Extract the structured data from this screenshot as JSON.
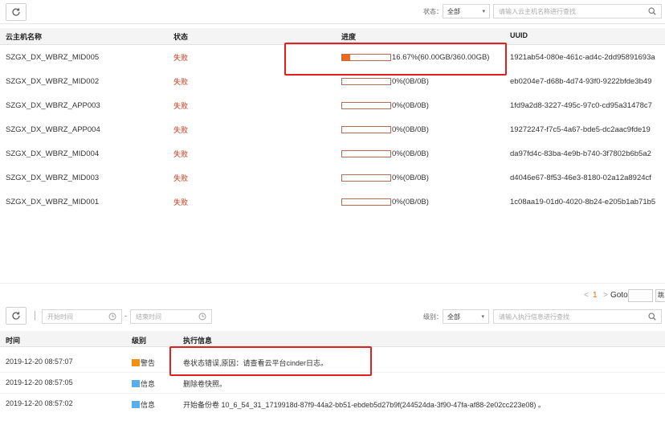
{
  "colors": {
    "accent": "#ee6a1b",
    "fail": "#d0361a",
    "warning": "#f0900f",
    "info": "#58aee8",
    "highlight": "#e22020"
  },
  "top_toolbar": {
    "status_label": "状态：",
    "status_value": "全部",
    "search_placeholder": "请输入云主机名称进行查找"
  },
  "vm_table": {
    "headers": {
      "name": "云主机名称",
      "status": "状态",
      "progress": "进度",
      "uuid": "UUID"
    },
    "rows": [
      {
        "name": "SZGX_DX_WBRZ_MID005",
        "status": "失败",
        "progress_pct": 16.67,
        "progress_text": "16.67%(60.00GB/360.00GB)",
        "uuid": "1921ab54-080e-461c-ad4c-2dd95891693a"
      },
      {
        "name": "SZGX_DX_WBRZ_MID002",
        "status": "失败",
        "progress_pct": 0,
        "progress_text": "0%(0B/0B)",
        "uuid": "eb0204e7-d68b-4d74-93f0-9222bfde3b49"
      },
      {
        "name": "SZGX_DX_WBRZ_APP003",
        "status": "失败",
        "progress_pct": 0,
        "progress_text": "0%(0B/0B)",
        "uuid": "1fd9a2d8-3227-495c-97c0-cd95a31478c7"
      },
      {
        "name": "SZGX_DX_WBRZ_APP004",
        "status": "失败",
        "progress_pct": 0,
        "progress_text": "0%(0B/0B)",
        "uuid": "19272247-f7c5-4a67-bde5-dc2aac9fde19"
      },
      {
        "name": "SZGX_DX_WBRZ_MID004",
        "status": "失败",
        "progress_pct": 0,
        "progress_text": "0%(0B/0B)",
        "uuid": "da97fd4c-83ba-4e9b-b740-3f7802b6b5a2"
      },
      {
        "name": "SZGX_DX_WBRZ_MID003",
        "status": "失败",
        "progress_pct": 0,
        "progress_text": "0%(0B/0B)",
        "uuid": "d4046e67-8f53-46e3-8180-02a12a8924cf"
      },
      {
        "name": "SZGX_DX_WBRZ_MID001",
        "status": "失败",
        "progress_pct": 0,
        "progress_text": "0%(0B/0B)",
        "uuid": "1c08aa19-01d0-4020-8b24-e205b1ab71b5"
      }
    ]
  },
  "pagination": {
    "prev": "<",
    "current": "1",
    "next": ">",
    "goto_label": "Goto",
    "jump_label": "跳"
  },
  "log_toolbar": {
    "start_placeholder": "开始时间",
    "separator": "-",
    "end_placeholder": "结束时间",
    "level_label": "级别：",
    "level_value": "全部",
    "search_placeholder": "请输入执行信息进行查找"
  },
  "log_table": {
    "headers": {
      "time": "时间",
      "level": "级别",
      "message": "执行信息"
    },
    "rows": [
      {
        "time": "2019-12-20 08:57:07",
        "level": "警告",
        "level_color": "#f0900f",
        "message": "卷状态错误,原因：请查看云平台cinder日志。"
      },
      {
        "time": "2019-12-20 08:57:05",
        "level": "信息",
        "level_color": "#58aee8",
        "message": "删除卷快照。"
      },
      {
        "time": "2019-12-20 08:57:02",
        "level": "信息",
        "level_color": "#58aee8",
        "message": "开始备份卷 10_6_54_31_1719918d-87f9-44a2-bb51-ebdeb5d27b9f(244524da-3f90-47fa-af88-2e02cc223e08) 。"
      }
    ]
  }
}
